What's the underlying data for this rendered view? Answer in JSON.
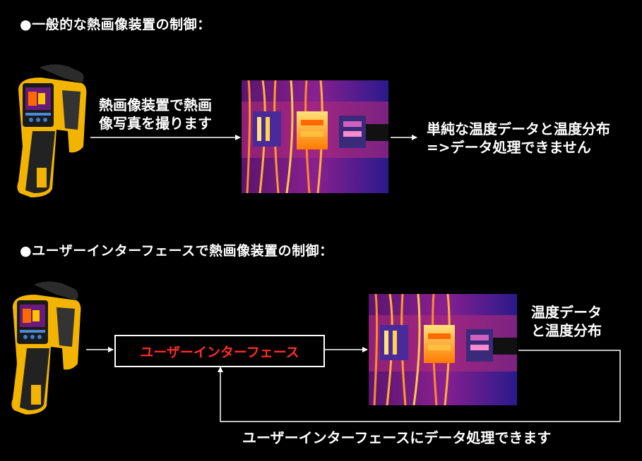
{
  "section1": {
    "heading": "●一般的な熱画像装置の制御：",
    "capture_line1": "熱画像装置で熱画",
    "capture_line2": "像写真を撮ります",
    "result_line1": "単純な温度データと温度分布",
    "result_line2": "=>データ処理できません"
  },
  "section2": {
    "heading": "●ユーザーインターフェースで熱画像装置の制御：",
    "ui_box_label": "ユーザーインターフェース",
    "result_line1": "温度データ",
    "result_line2": "と温度分布",
    "feedback_label": "ユーザーインターフェースにデータ処理できます"
  },
  "colors": {
    "background": "#000000",
    "text": "#ffffff",
    "ui_label": "#ff2b2b",
    "camera_body": "#f2b400",
    "thermal_hot": "#ffd34d",
    "thermal_cold": "#2a1a8c"
  },
  "icons": [
    "thermal-camera",
    "thermal-image",
    "arrow-right"
  ]
}
